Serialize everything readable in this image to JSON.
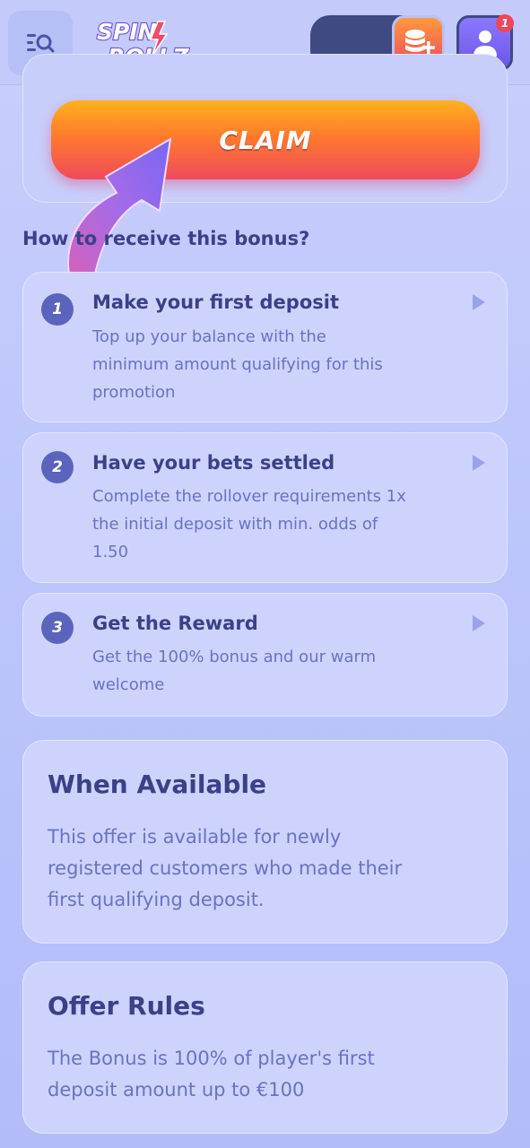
{
  "header": {
    "logo_line1": "SPIN",
    "logo_line2": "ROLLZ",
    "notification_count": "1",
    "icons": {
      "menu": "menu-search-icon",
      "deposit": "coins-plus-icon",
      "profile": "user-icon"
    },
    "colors": {
      "deposit_gradient_top": "#ff9a3c",
      "deposit_gradient_bottom": "#ef4b5a",
      "badge": "#f0465c"
    }
  },
  "claim": {
    "label": "CLAIM"
  },
  "steps_section": {
    "heading": "How to receive this bonus?",
    "steps": [
      {
        "number": "1",
        "title": "Make your first deposit",
        "lines": [
          "Top up your balance with the",
          "minimum amount qualifying for this",
          "promotion"
        ]
      },
      {
        "number": "2",
        "title": "Have your bets settled",
        "lines": [
          "Complete the rollover requirements 1x",
          "the initial deposit with min. odds of",
          "1.50"
        ]
      },
      {
        "number": "3",
        "title": "Get the Reward",
        "lines": [
          "Get the 100% bonus and our warm",
          "welcome"
        ]
      }
    ]
  },
  "when_available": {
    "title": "When Available",
    "lines": [
      "This offer is available for newly",
      "registered customers who made their",
      "first qualifying deposit."
    ]
  },
  "offer_rules": {
    "title": "Offer Rules",
    "lines": [
      "The Bonus is 100% of player's first",
      "deposit amount up to €100"
    ]
  }
}
